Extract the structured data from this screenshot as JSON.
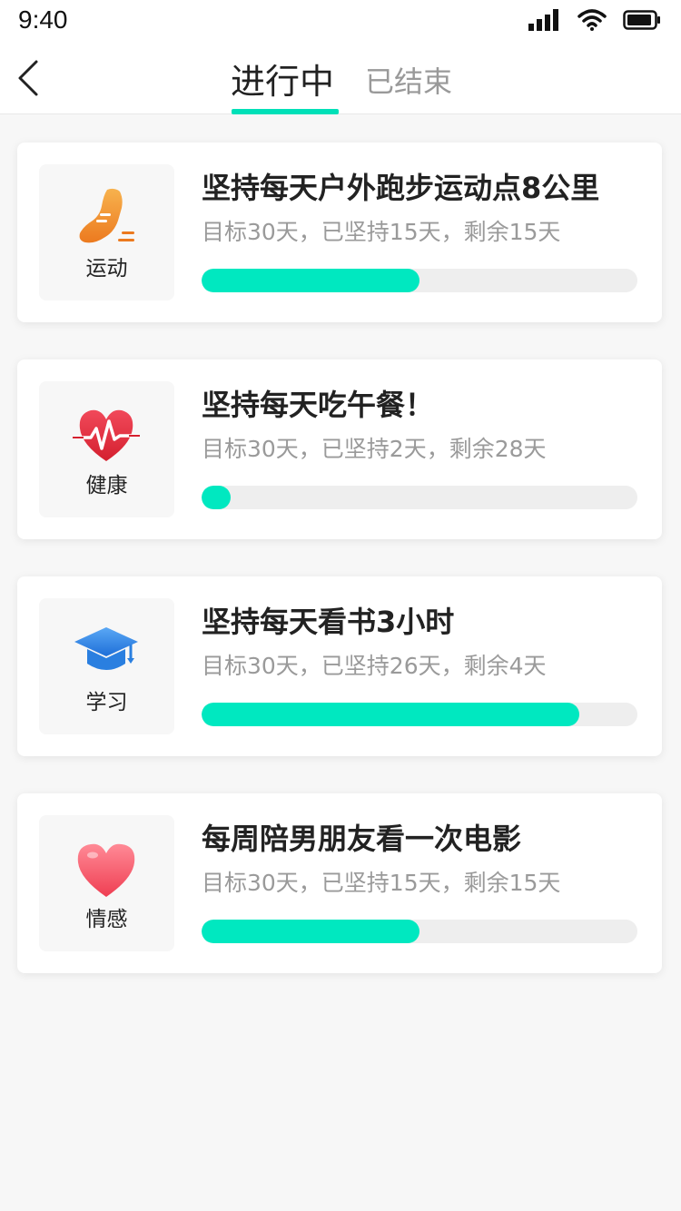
{
  "status": {
    "time": "9:40"
  },
  "nav": {
    "tab_active": "进行中",
    "tab_inactive": "已结束",
    "accent_color": "#00e0b8"
  },
  "cards": [
    {
      "category": "运动",
      "icon": "running-shoe-icon",
      "title": "坚持每天户外跑步运动点8公里",
      "subtitle": "目标30天，已坚持15天，剩余15天",
      "progress": 0.5
    },
    {
      "category": "健康",
      "icon": "heartbeat-icon",
      "title": "坚持每天吃午餐！",
      "subtitle": "目标30天，已坚持2天，剩余28天",
      "progress": 0.0667
    },
    {
      "category": "学习",
      "icon": "graduation-cap-icon",
      "title": "坚持每天看书3小时",
      "subtitle": "目标30天，已坚持26天，剩余4天",
      "progress": 0.8667
    },
    {
      "category": "情感",
      "icon": "heart-icon",
      "title": "每周陪男朋友看一次电影",
      "subtitle": "目标30天，已坚持15天，剩余15天",
      "progress": 0.5
    }
  ]
}
